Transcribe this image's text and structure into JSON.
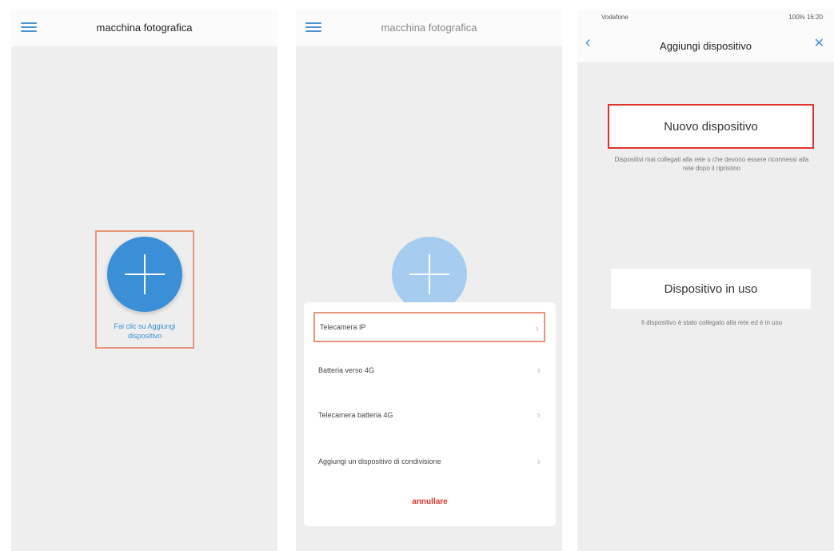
{
  "screen1": {
    "header_title": "macchina fotografica",
    "add_label": "Fai clic su Aggiungi dispositivo"
  },
  "screen2": {
    "header_title": "macchina fotografica",
    "menu_items": [
      "Telecamera IP",
      "Batteria verso 4G",
      "Telecamera batteria 4G",
      "Aggiungi un dispositivo di condivisione"
    ],
    "cancel_label": "annullare"
  },
  "screen3": {
    "status_left": "Vodafone",
    "status_right": "100% 16:20",
    "nav_title": "Aggiungi dispositivo",
    "new_device": {
      "label": "Nuovo dispositivo",
      "description": "Dispositivi mai collegati alla rete o che devono essere riconnessi alla rete dopo il ripristino"
    },
    "used_device": {
      "label": "Dispositivo in uso",
      "description": "Il dispositivo è stato collegato alla rete ed è in uso"
    }
  },
  "colors": {
    "accent_blue": "#3a8fd6",
    "highlight_orange": "#e8957b",
    "cancel_red": "#e0332a"
  }
}
